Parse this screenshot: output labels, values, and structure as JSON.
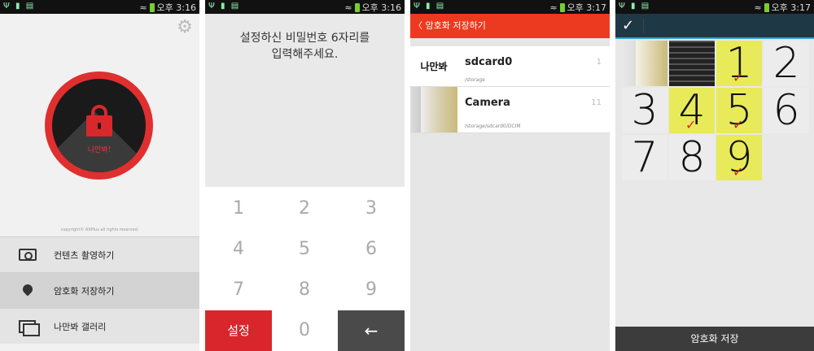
{
  "status_bars": [
    {
      "time": "오후 3:16"
    },
    {
      "time": "오후 3:16"
    },
    {
      "time": "오후 3:17"
    },
    {
      "time": "오후 3:17"
    }
  ],
  "home": {
    "logo_text": "나만봐!",
    "copyright": "copyright© AltPlus all rights reserved.",
    "menu": [
      {
        "label": "컨텐츠 촬영하기",
        "icon": "camera-icon"
      },
      {
        "label": "암호화 저장하기",
        "icon": "location-pin-icon"
      },
      {
        "label": "나만봐 갤러리",
        "icon": "gallery-icon"
      }
    ]
  },
  "pin": {
    "prompt_line1": "설정하신 비밀번호 6자리를",
    "prompt_line2": "입력해주세요.",
    "keys": [
      "1",
      "2",
      "3",
      "4",
      "5",
      "6",
      "7",
      "8",
      "9"
    ],
    "set_label": "설정",
    "zero": "0",
    "back_glyph": "←"
  },
  "folders": {
    "title": "〈 암호화 저장하기",
    "items": [
      {
        "name": "sdcard0",
        "path": "/storage",
        "count": "1",
        "thumb_text": "나만봐"
      },
      {
        "name": "Camera",
        "path": "/storage/sdcard0/DCIM",
        "count": "11",
        "thumb_text": ""
      }
    ]
  },
  "gallery": {
    "confirm_glyph": "✓",
    "digits": [
      "1",
      "2",
      "3",
      "4",
      "5",
      "6",
      "7",
      "8",
      "9"
    ],
    "selected_digits": [
      "1",
      "4",
      "5",
      "9"
    ],
    "check_glyph": "✓",
    "save_label": "암호화 저장"
  },
  "colors": {
    "accent_red": "#d8262c",
    "header_orange": "#ec3a20",
    "highlight_yellow": "#e8ea5a",
    "gallery_bar": "#1f3845"
  }
}
